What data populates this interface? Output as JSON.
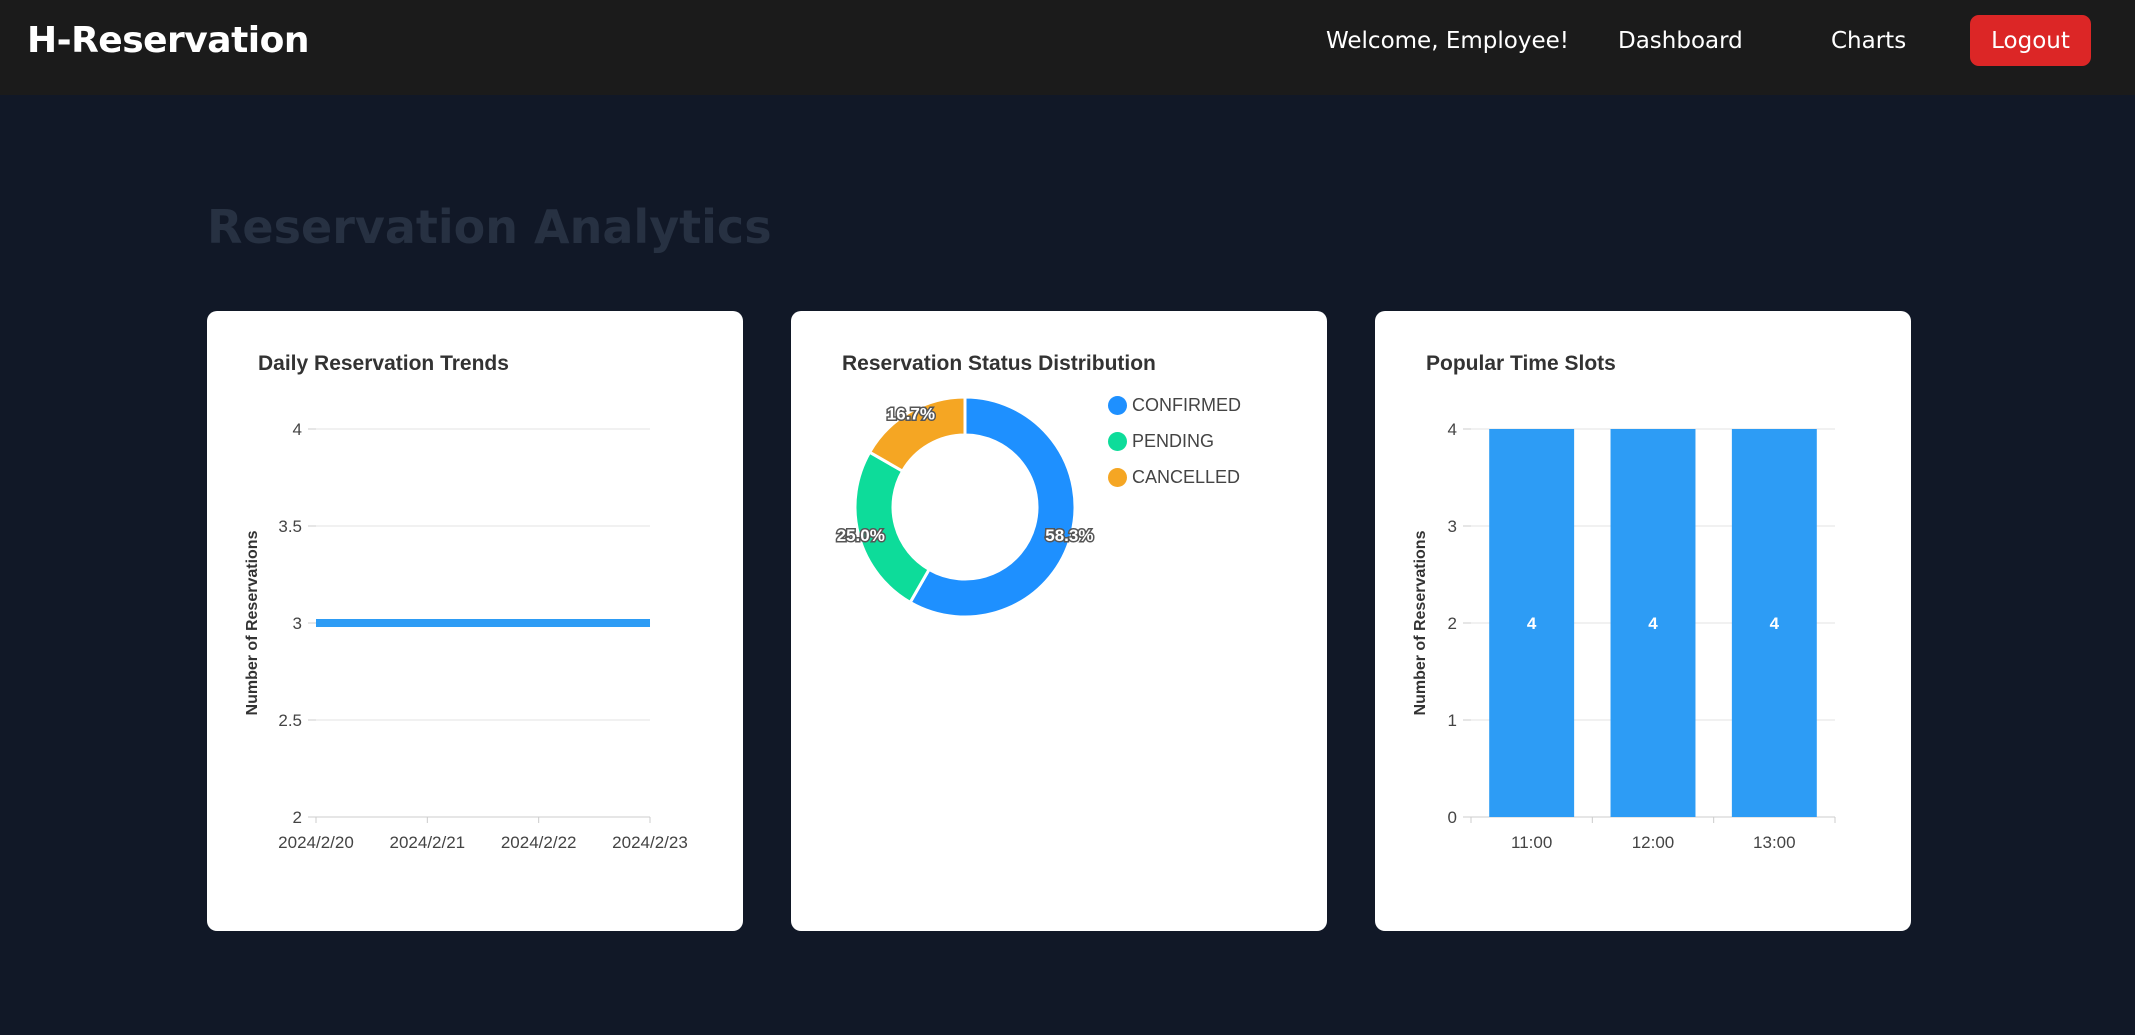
{
  "nav": {
    "brand": "H-Reservation",
    "welcome": "Welcome, Employee!",
    "links": [
      "Dashboard",
      "Charts"
    ],
    "logout": "Logout"
  },
  "page": {
    "title": "Reservation Analytics"
  },
  "colors": {
    "page_bg": "#111827",
    "navbar_bg": "#1b1b1b",
    "logout_bg": "#dc2626",
    "series_blue": "#2d9cf5",
    "confirmed": "#1e90ff",
    "pending": "#0ddc9a",
    "cancelled": "#f5a623"
  },
  "chart_data": [
    {
      "type": "line",
      "title": "Daily Reservation Trends",
      "xlabel": "",
      "ylabel": "Number of Reservations",
      "x": [
        "2024/2/20",
        "2024/2/21",
        "2024/2/22",
        "2024/2/23"
      ],
      "y_ticks": [
        "4",
        "3.5",
        "3",
        "2.5",
        "2"
      ],
      "ylim": [
        2,
        4
      ],
      "series": [
        {
          "values": [
            3,
            3,
            3,
            3
          ]
        }
      ],
      "grid": true
    },
    {
      "type": "pie",
      "title": "Reservation Status Distribution",
      "donut": true,
      "slices": [
        {
          "label": "CONFIRMED",
          "value": 58.3,
          "display": "58.3%"
        },
        {
          "label": "PENDING",
          "value": 25.0,
          "display": "25.0%"
        },
        {
          "label": "CANCELLED",
          "value": 16.7,
          "display": "16.7%"
        }
      ],
      "legend_position": "right"
    },
    {
      "type": "bar",
      "title": "Popular Time Slots",
      "xlabel": "",
      "ylabel": "Number of Reservations",
      "categories": [
        "11:00",
        "12:00",
        "13:00"
      ],
      "values": [
        4,
        4,
        4
      ],
      "value_labels": [
        "4",
        "4",
        "4"
      ],
      "y_ticks": [
        "4",
        "3",
        "2",
        "1",
        "0"
      ],
      "ylim": [
        0,
        4
      ],
      "grid": true
    }
  ]
}
